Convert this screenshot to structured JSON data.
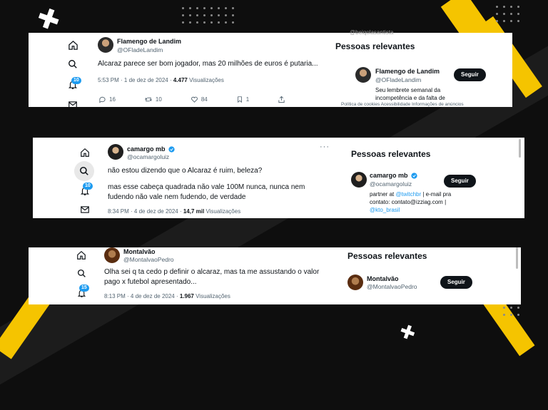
{
  "screenshots": [
    {
      "author": {
        "name": "Flamengo de Landim",
        "handle": "@OFladeLandim"
      },
      "tweet": "Alcaraz parece ser bom jogador, mas 20 milhões de euros é putaria...",
      "time": "5:53 PM · 1 de dez de 2024 · ",
      "views_count": "4.477",
      "views_label": "Visualizações",
      "actions": {
        "replies": "16",
        "retweets": "10",
        "likes": "84",
        "bookmarks": "1"
      },
      "badge": "10",
      "sidebar": {
        "title": "Pessoas relevantes",
        "name": "Flamengo de Landim",
        "handle": "@OFladeLandim",
        "follow": "Seguir",
        "bio": "Seu lembrete semanal da incompetência e da falta de"
      },
      "footer": "Política de cookies   Acessibilidade   Informações de anúncios",
      "peek_handle": "@beiqolasantista"
    },
    {
      "author": {
        "name": "camargo mb",
        "handle": "@ocamargoluiz"
      },
      "tweet_line1": "não estou dizendo que o Alcaraz é ruim, beleza?",
      "tweet_line2": "mas esse cabeça quadrada não vale 100M nunca, nunca nem fudendo não vale nem fudendo, de verdade",
      "time": "8:34 PM · 4 de dez de 2024 · ",
      "views_count": "14,7 mil",
      "views_label": "Visualizações",
      "badge": "10",
      "sidebar": {
        "title": "Pessoas relevantes",
        "name": "camargo mb",
        "handle": "@ocamargoluiz",
        "follow": "Seguir",
        "bio_prefix": "partner at ",
        "bio_link1": "@twitchbr",
        "bio_mid": " | e-mail pra contato: contato@izziag.com | ",
        "bio_link2": "@kto_brasil"
      }
    },
    {
      "author": {
        "name": "Montalvão",
        "handle": "@MontalvaoPedro"
      },
      "tweet": "Olha sei q ta cedo p definir o alcaraz, mas ta me assustando o valor pago x futebol apresentado...",
      "time": "8:13 PM · 4 de dez de 2024 · ",
      "views_count": "1.967",
      "views_label": "Visualizações",
      "badge": "15",
      "sidebar": {
        "title": "Pessoas relevantes",
        "name": "Montalvão",
        "handle": "@MontalvaoPedro",
        "follow": "Seguir"
      }
    }
  ],
  "colors": {
    "accent": "#1d9bf0",
    "brand_yellow": "#f5c400",
    "background": "#0e0e0e"
  }
}
